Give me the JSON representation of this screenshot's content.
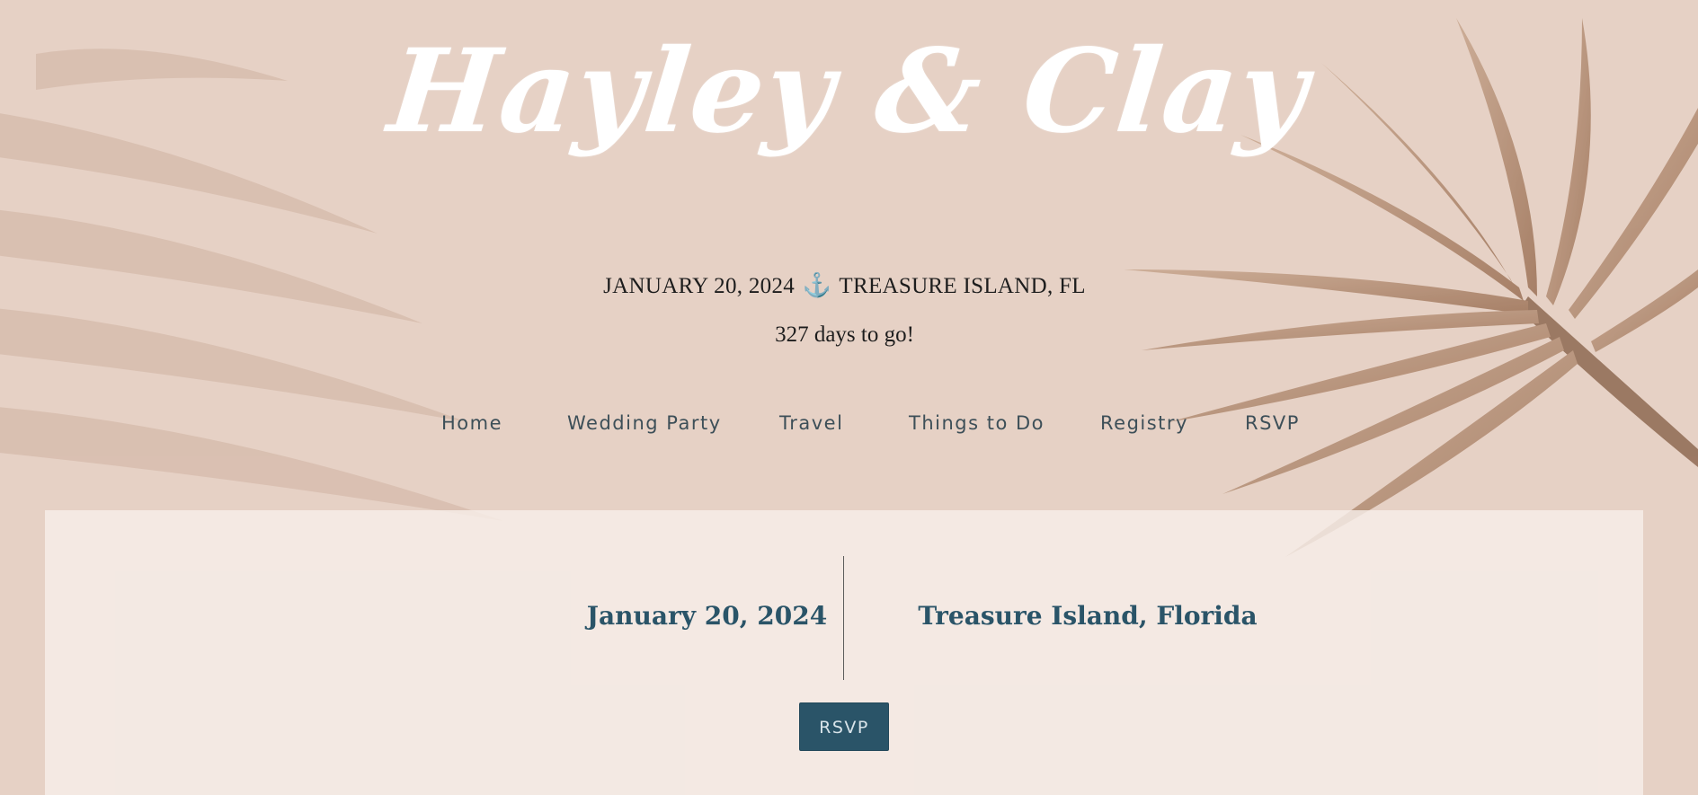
{
  "header": {
    "title": "Hayley & Clay",
    "date_line": "JANUARY 20, 2024",
    "anchor_glyph": "⚓",
    "location_line": "TREASURE ISLAND, FL",
    "countdown": "327 days to go!"
  },
  "nav": {
    "items": [
      {
        "label": "Home"
      },
      {
        "label": "Wedding Party"
      },
      {
        "label": "Travel"
      },
      {
        "label": "Things to Do"
      },
      {
        "label": "Registry"
      },
      {
        "label": "RSVP"
      }
    ]
  },
  "details": {
    "date": "January 20, 2024",
    "location": "Treasure Island, Florida",
    "rsvp_label": "RSVP"
  },
  "icons": {
    "anchor": "anchor-icon"
  },
  "colors": {
    "background": "#e6d1c5",
    "panel": "#f6eee9",
    "accent": "#2a5468",
    "nav_text": "#3d4f58",
    "leaf": "#a47c61"
  }
}
